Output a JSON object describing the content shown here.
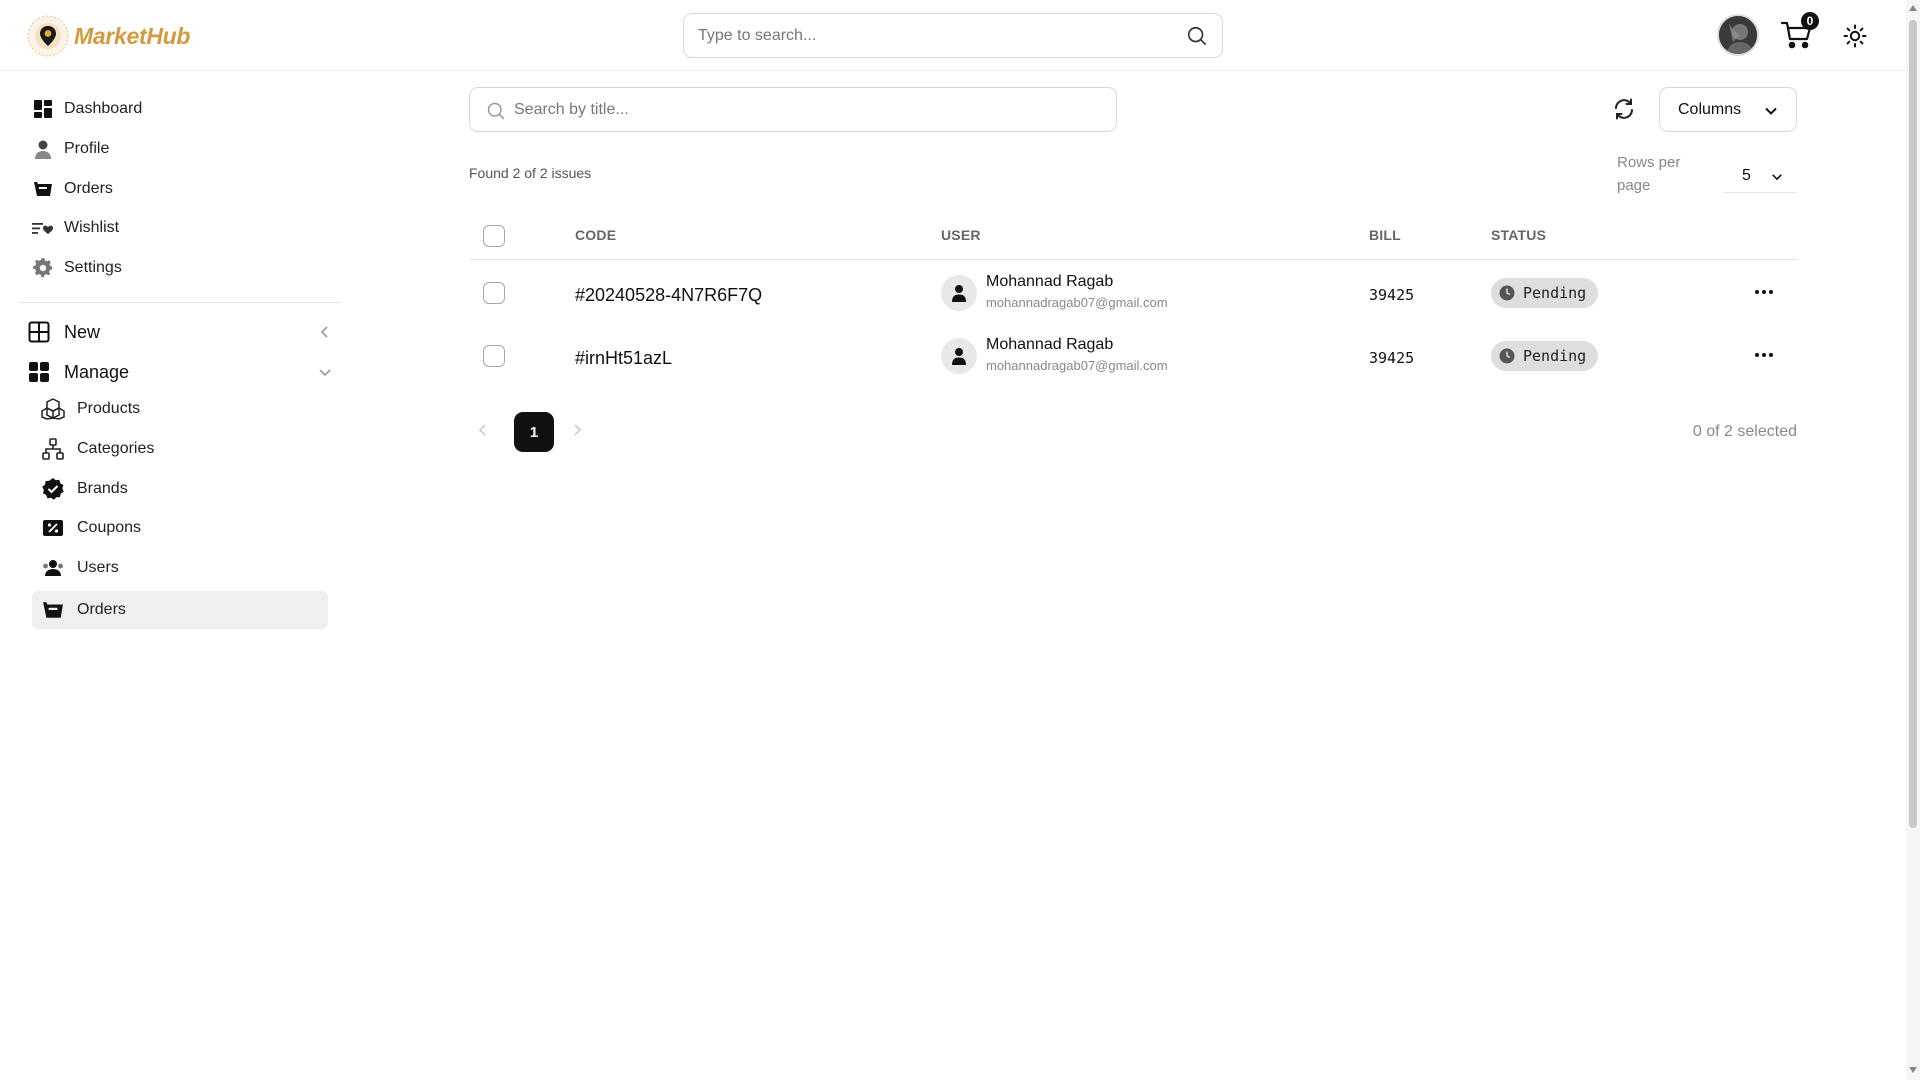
{
  "header": {
    "brand": "MarketHub",
    "search_placeholder": "Type to search...",
    "cart_count": "0",
    "icons": [
      "search-icon",
      "cart-icon",
      "sun-icon"
    ]
  },
  "sidebar": {
    "items": [
      {
        "label": "Dashboard",
        "icon": "dashboard-icon"
      },
      {
        "label": "Profile",
        "icon": "user-icon"
      },
      {
        "label": "Orders",
        "icon": "basket-icon"
      },
      {
        "label": "Wishlist",
        "icon": "wishlist-icon"
      },
      {
        "label": "Settings",
        "icon": "gear-icon"
      }
    ],
    "groups": [
      {
        "label": "New",
        "icon": "grid-plus-icon",
        "expanded": false
      },
      {
        "label": "Manage",
        "icon": "grid-icon",
        "expanded": true
      }
    ],
    "manage_items": [
      {
        "label": "Products",
        "icon": "boxes-icon"
      },
      {
        "label": "Categories",
        "icon": "hierarchy-icon"
      },
      {
        "label": "Brands",
        "icon": "badge-check-icon"
      },
      {
        "label": "Coupons",
        "icon": "coupon-icon"
      },
      {
        "label": "Users",
        "icon": "users-icon"
      },
      {
        "label": "Orders",
        "icon": "basket-icon",
        "active": true
      }
    ]
  },
  "main": {
    "search_placeholder": "Search by title...",
    "columns_label": "Columns",
    "found_text": "Found 2 of 2 issues",
    "rows_per_page_label": "Rows per page",
    "rows_per_page_value": "5",
    "columns": [
      "CODE",
      "USER",
      "BILL",
      "STATUS"
    ],
    "rows": [
      {
        "code": "#20240528-4N7R6F7Q",
        "user_name": "Mohannad Ragab",
        "user_email": "mohannadragab07@gmail.com",
        "bill": "39425",
        "status": "Pending"
      },
      {
        "code": "#irnHt51azL",
        "user_name": "Mohannad Ragab",
        "user_email": "mohannadragab07@gmail.com",
        "bill": "39425",
        "status": "Pending"
      }
    ],
    "pagination": {
      "current_page": "1"
    },
    "selected_text": "0 of 2 selected"
  },
  "colors": {
    "brand": "#d49a3e",
    "active_bg": "#efefef",
    "status_bg": "#dedede",
    "pager_active": "#111111"
  }
}
